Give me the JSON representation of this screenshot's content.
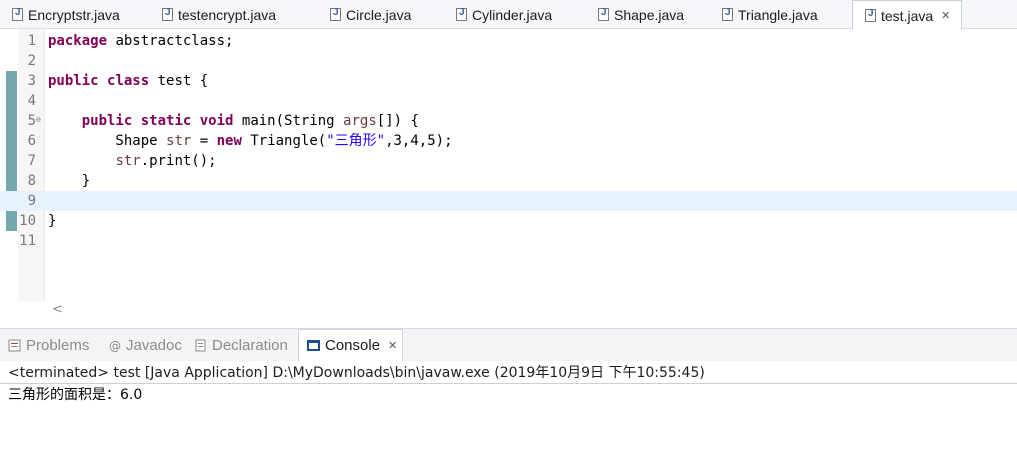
{
  "editor_tabs": [
    {
      "label": "Encryptstr.java"
    },
    {
      "label": "testencrypt.java"
    },
    {
      "label": "Circle.java"
    },
    {
      "label": "Cylinder.java"
    },
    {
      "label": "Shape.java"
    },
    {
      "label": "Triangle.java"
    },
    {
      "label": "test.java",
      "active": true
    }
  ],
  "tab_close_glyph": "✕",
  "code_lines": [
    {
      "num": "1",
      "tokens": [
        [
          "kw",
          "package"
        ],
        [
          "t",
          " abstractclass;"
        ]
      ]
    },
    {
      "num": "2",
      "tokens": []
    },
    {
      "num": "3",
      "tokens": [
        [
          "kw",
          "public"
        ],
        [
          "t",
          " "
        ],
        [
          "kw",
          "class"
        ],
        [
          "t",
          " test {"
        ]
      ]
    },
    {
      "num": "4",
      "tokens": []
    },
    {
      "num": "5",
      "fold": true,
      "tokens": [
        [
          "t",
          "    "
        ],
        [
          "kw",
          "public"
        ],
        [
          "t",
          " "
        ],
        [
          "kw",
          "static"
        ],
        [
          "t",
          " "
        ],
        [
          "kw",
          "void"
        ],
        [
          "t",
          " main(String "
        ],
        [
          "var",
          "args"
        ],
        [
          "t",
          "[]) {"
        ]
      ]
    },
    {
      "num": "6",
      "tokens": [
        [
          "t",
          "        Shape "
        ],
        [
          "var",
          "str"
        ],
        [
          "t",
          " = "
        ],
        [
          "kw",
          "new"
        ],
        [
          "t",
          " Triangle("
        ],
        [
          "str",
          "\"三角形\""
        ],
        [
          "t",
          ",3,4,5);"
        ]
      ]
    },
    {
      "num": "7",
      "tokens": [
        [
          "t",
          "        "
        ],
        [
          "var",
          "str"
        ],
        [
          "t",
          ".print();"
        ]
      ]
    },
    {
      "num": "8",
      "tokens": [
        [
          "t",
          "    }"
        ]
      ]
    },
    {
      "num": "9",
      "current": true,
      "tokens": []
    },
    {
      "num": "10",
      "tokens": [
        [
          "t",
          "}"
        ]
      ]
    },
    {
      "num": "11",
      "tokens": []
    }
  ],
  "fold_glyph": "⊖",
  "scroll_left_glyph": "<",
  "view_tabs": [
    {
      "label": "Problems",
      "icon": "problems-icon"
    },
    {
      "label": "Javadoc",
      "icon": "javadoc-icon"
    },
    {
      "label": "Declaration",
      "icon": "declaration-icon"
    },
    {
      "label": "Console",
      "icon": "console-icon",
      "active": true
    }
  ],
  "console": {
    "status": "<terminated> test [Java Application] D:\\MyDownloads\\bin\\javaw.exe (2019年10月9日 下午10:55:45)",
    "output": "三角形的面积是：6.0"
  },
  "colors": {
    "keyword": "#7f0055",
    "string": "#2a00ff",
    "variable": "#6a3e3e",
    "current_line": "#e8f2fe"
  }
}
